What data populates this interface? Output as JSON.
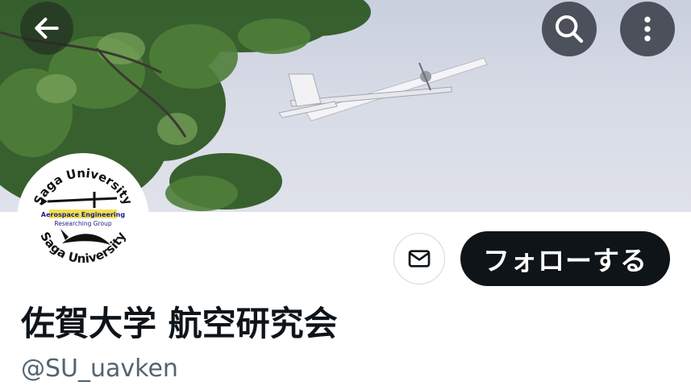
{
  "header": {
    "back_icon": "arrow-left-icon",
    "search_icon": "search-icon",
    "more_icon": "more-vertical-icon"
  },
  "banner": {
    "description_icon": "airplane-photo"
  },
  "avatar": {
    "top_text": "Saga University",
    "bottom_text": "Saga University",
    "line1": "Aerospace Engineering",
    "line2": "Researching Group"
  },
  "actions": {
    "message_icon": "mail-icon",
    "follow_label": "フォローする"
  },
  "profile": {
    "display_name": "佐賀大学 航空研究会",
    "handle": "@SU_uavken"
  }
}
